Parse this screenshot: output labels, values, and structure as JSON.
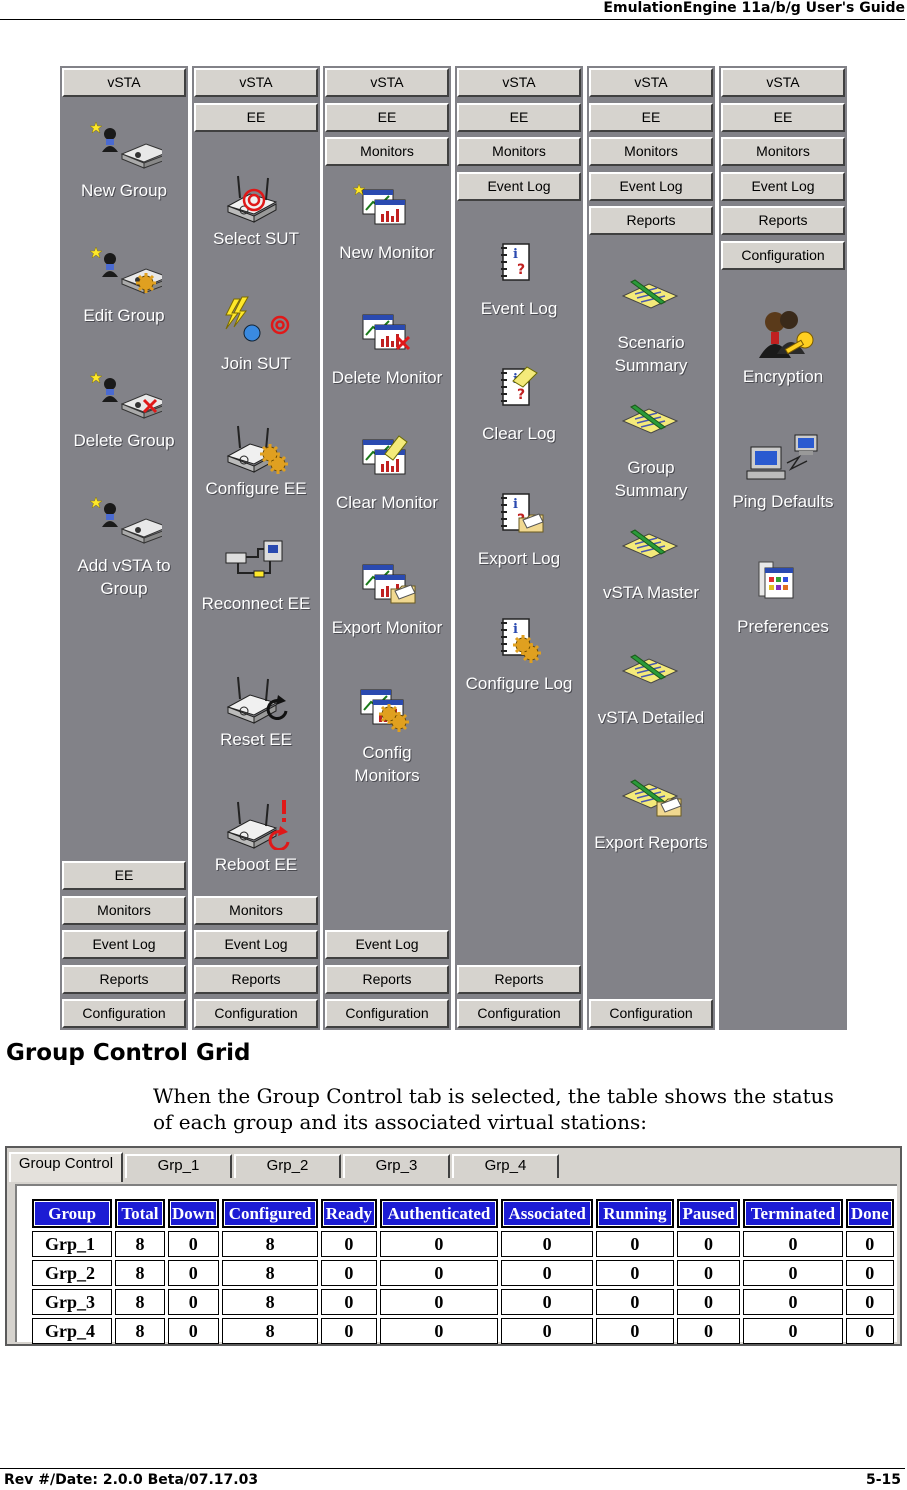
{
  "header": {
    "title": "EmulationEngine 11a/b/g User's Guide"
  },
  "footer": {
    "left": "Rev #/Date: 2.0.0 Beta/07.17.03",
    "right": "5-15"
  },
  "panels": [
    {
      "top_buttons": [
        "vSTA"
      ],
      "items": [
        "New Group",
        "Edit Group",
        "Delete Group",
        "Add vSTA to\nGroup"
      ],
      "bottom_buttons": [
        "EE",
        "Monitors",
        "Event Log",
        "Reports",
        "Configuration"
      ]
    },
    {
      "top_buttons": [
        "vSTA",
        "EE"
      ],
      "items": [
        "Select SUT",
        "Join SUT",
        "Configure EE",
        "Reconnect EE",
        "Reset EE",
        "Reboot EE"
      ],
      "bottom_buttons": [
        "Monitors",
        "Event Log",
        "Reports",
        "Configuration"
      ]
    },
    {
      "top_buttons": [
        "vSTA",
        "EE",
        "Monitors"
      ],
      "items": [
        "New Monitor",
        "Delete Monitor",
        "Clear Monitor",
        "Export Monitor",
        "Config\nMonitors"
      ],
      "bottom_buttons": [
        "Event Log",
        "Reports",
        "Configuration"
      ]
    },
    {
      "top_buttons": [
        "vSTA",
        "EE",
        "Monitors",
        "Event Log"
      ],
      "items": [
        "Event Log",
        "Clear Log",
        "Export Log",
        "Configure Log"
      ],
      "bottom_buttons": [
        "Reports",
        "Configuration"
      ]
    },
    {
      "top_buttons": [
        "vSTA",
        "EE",
        "Monitors",
        "Event Log",
        "Reports"
      ],
      "items": [
        "Scenario\nSummary",
        "Group\nSummary",
        "vSTA Master",
        "vSTA Detailed",
        "Export Reports"
      ],
      "bottom_buttons": [
        "Configuration"
      ]
    },
    {
      "top_buttons": [
        "vSTA",
        "EE",
        "Monitors",
        "Event Log",
        "Reports",
        "Configuration"
      ],
      "items": [
        "Encryption",
        "Ping Defaults",
        "Preferences"
      ],
      "bottom_buttons": []
    }
  ],
  "section": {
    "title": "Group Control Grid",
    "text": "When the Group Control tab is selected, the table shows the status of each group and its associated virtual stations:"
  },
  "group_control": {
    "tabs": [
      "Group Control",
      "Grp_1",
      "Grp_2",
      "Grp_3",
      "Grp_4"
    ],
    "active_tab": 0,
    "columns": [
      "Group",
      "Total",
      "Down",
      "Configured",
      "Ready",
      "Authenticated",
      "Associated",
      "Running",
      "Paused",
      "Terminated",
      "Done"
    ],
    "rows": [
      [
        "Grp_1",
        "8",
        "0",
        "8",
        "0",
        "0",
        "0",
        "0",
        "0",
        "0",
        "0"
      ],
      [
        "Grp_2",
        "8",
        "0",
        "8",
        "0",
        "0",
        "0",
        "0",
        "0",
        "0",
        "0"
      ],
      [
        "Grp_3",
        "8",
        "0",
        "8",
        "0",
        "0",
        "0",
        "0",
        "0",
        "0",
        "0"
      ],
      [
        "Grp_4",
        "8",
        "0",
        "8",
        "0",
        "0",
        "0",
        "0",
        "0",
        "0",
        "0"
      ]
    ]
  },
  "icons": {
    "panel_0": [
      "new-group-icon",
      "edit-group-icon",
      "delete-group-icon",
      "add-vsta-icon"
    ],
    "panel_1": [
      "select-sut-icon",
      "join-sut-icon",
      "configure-ee-icon",
      "reconnect-ee-icon",
      "reset-ee-icon",
      "reboot-ee-icon"
    ],
    "panel_2": [
      "new-monitor-icon",
      "delete-monitor-icon",
      "clear-monitor-icon",
      "export-monitor-icon",
      "config-monitors-icon"
    ],
    "panel_3": [
      "event-log-icon",
      "clear-log-icon",
      "export-log-icon",
      "configure-log-icon"
    ],
    "panel_4": [
      "report-icon",
      "report-icon",
      "report-icon",
      "report-icon",
      "export-reports-icon"
    ],
    "panel_5": [
      "encryption-icon",
      "ping-defaults-icon",
      "preferences-icon"
    ]
  },
  "colors": {
    "panel_bg": "#828288",
    "button_face": "#d6d3ce",
    "grid_header": "#1c1cd4"
  }
}
